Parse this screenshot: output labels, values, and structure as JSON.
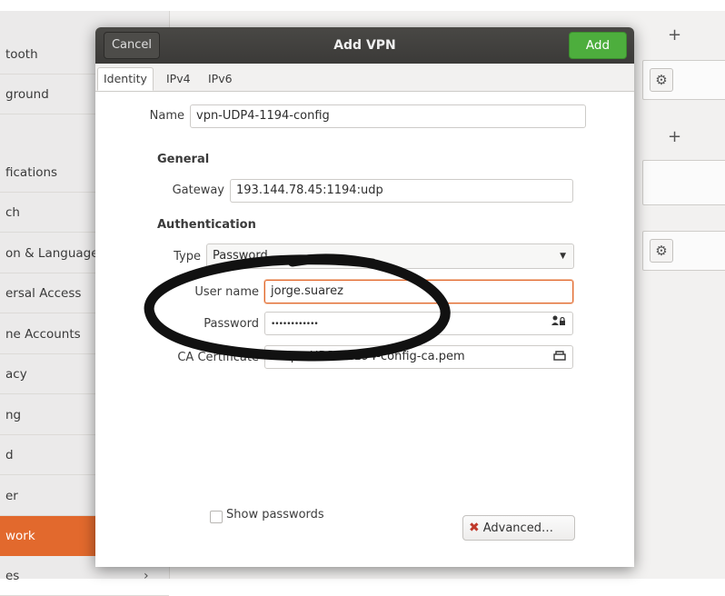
{
  "background": {
    "sidebar_items": [
      {
        "label": "tooth"
      },
      {
        "label": "ground"
      },
      {
        "label": "fications"
      },
      {
        "label": "ch"
      },
      {
        "label": "on & Language"
      },
      {
        "label": "ersal Access"
      },
      {
        "label": "ne Accounts"
      },
      {
        "label": "acy"
      },
      {
        "label": "ng"
      },
      {
        "label": "d"
      },
      {
        "label": "er"
      },
      {
        "label": "work"
      },
      {
        "label": "es"
      }
    ],
    "plus_label": "+",
    "gear_icon": "⚙",
    "chevron": "›"
  },
  "dialog": {
    "cancel_label": "Cancel",
    "title": "Add VPN",
    "add_label": "Add",
    "tabs": [
      {
        "label": "Identity"
      },
      {
        "label": "IPv4"
      },
      {
        "label": "IPv6"
      }
    ],
    "name_label": "Name",
    "name_value": "vpn-UDP4-1194-config",
    "general_heading": "General",
    "gateway_label": "Gateway",
    "gateway_value": "193.144.78.45:1194:udp",
    "auth_heading": "Authentication",
    "type_label": "Type",
    "type_value": "Password",
    "username_label": "User name",
    "username_value": "jorge.suarez",
    "password_label": "Password",
    "password_value": "••••••••••••",
    "ca_label": "CA Certificate",
    "ca_value": "vpn-UDP4-1194-config-ca.pem",
    "show_passwords_label": "Show passwords",
    "advanced_label": "Advanced…",
    "advanced_icon": "✖"
  },
  "colors": {
    "accent": "#e2692d",
    "add_button": "#4dae3d",
    "titlebar": "#3b3a38",
    "marker": "#111111"
  }
}
